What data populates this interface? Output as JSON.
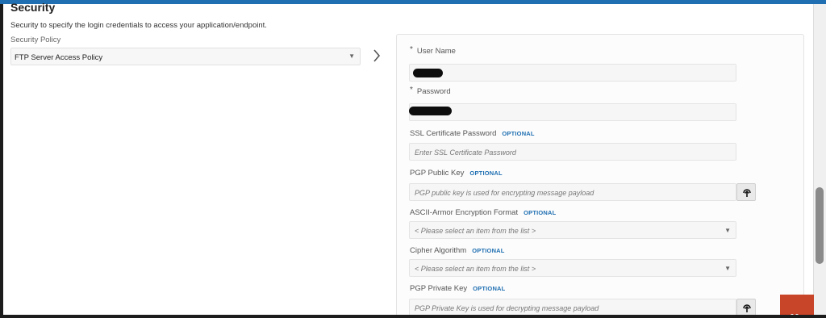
{
  "section": {
    "title": "Security",
    "description": "Security to specify the login credentials to access your application/endpoint.",
    "policy_label": "Security Policy",
    "policy_value": "FTP Server Access Policy"
  },
  "form": {
    "optional_tag": "OPTIONAL",
    "required_marker": "*",
    "username_label": "User Name",
    "password_label": "Password",
    "ssl_label": "SSL Certificate Password",
    "ssl_placeholder": "Enter SSL Certificate Password",
    "pgp_public_label": "PGP Public Key",
    "pgp_public_placeholder": "PGP public key is used for encrypting message payload",
    "ascii_label": "ASCII-Armor Encryption Format",
    "ascii_placeholder": "< Please select an item from the list >",
    "cipher_label": "Cipher Algorithm",
    "cipher_placeholder": "< Please select an item from the list >",
    "pgp_private_label": "PGP Private Key",
    "pgp_private_placeholder": "PGP Private Key is used for decrypting message payload"
  },
  "icons": {
    "policy_dropdown": "caret-down-icon",
    "expand": "chevron-right-icon",
    "upload": "upload-icon",
    "chat": "chat-icon"
  },
  "colors": {
    "accent": "#1f6fb2",
    "optional_tag": "#1f6fb2",
    "chat_button": "#c9452a"
  }
}
